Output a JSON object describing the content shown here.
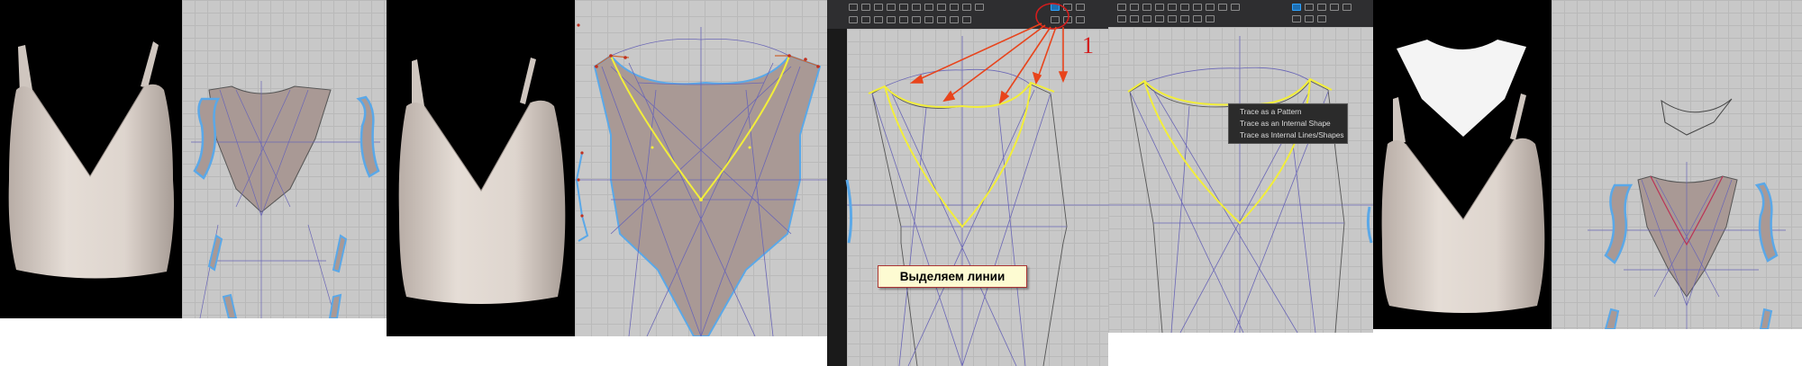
{
  "annotation": {
    "step_number": "1",
    "label": "Выделяем линии"
  },
  "context_menu": {
    "items": [
      "Trace as a Pattern",
      "Trace as an Internal Shape",
      "Trace as Internal Lines/Shapes"
    ]
  },
  "colors": {
    "viewport_3d_bg": "#000000",
    "pattern_bg": "#c8c8c8",
    "fabric": "#dcd3cc",
    "pattern_fill": "#a99995",
    "selected_lines": "#f2ee3a",
    "internal_lines": "#6a66b6",
    "outline_highlight": "#5aa8e8",
    "arrow": "#e8441c",
    "toolbar_bg": "#2e2e30"
  },
  "icons": [
    "trace-tool-icon"
  ]
}
